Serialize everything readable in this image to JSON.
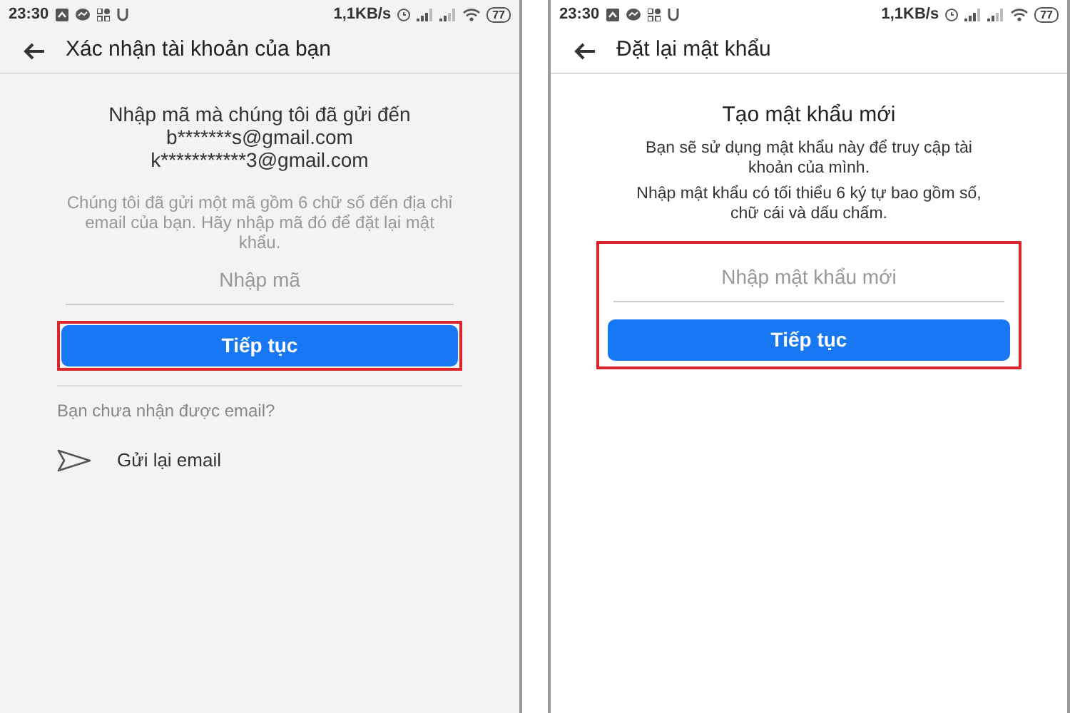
{
  "screens": [
    {
      "kind": "verify",
      "status_bar": {
        "time": "23:30",
        "speed": "1,1KB/s",
        "battery": "77"
      },
      "header": {
        "title": "Xác nhận tài khoản của bạn"
      },
      "message_lines": [
        "Nhập mã mà chúng tôi đã gửi đến",
        "b*******s@gmail.com",
        "k***********3@gmail.com"
      ],
      "hint": "Chúng tôi đã gửi một mã gồm 6 chữ số đến địa chỉ email của bạn. Hãy nhập mã đó để đặt lại mật khẩu.",
      "field": {
        "placeholder": "Nhập mã"
      },
      "button": {
        "label": "Tiếp tục",
        "highlighted": true
      },
      "question": "Bạn chưa nhận được email?",
      "resend": {
        "label": "Gửi lại email"
      }
    },
    {
      "kind": "reset",
      "status_bar": {
        "time": "23:30",
        "speed": "1,1KB/s",
        "battery": "77"
      },
      "header": {
        "title": "Đặt lại mật khẩu"
      },
      "heading": "Tạo mật khẩu mới",
      "description_lines": [
        "Bạn sẽ sử dụng mật khẩu này để truy cập tài khoản của mình.",
        "Nhập mật khẩu có tối thiểu 6 ký tự bao gồm số, chữ cái và dấu chấm."
      ],
      "field": {
        "placeholder": "Nhập mật khẩu mới"
      },
      "button": {
        "label": "Tiếp tục"
      },
      "highlighted": true
    }
  ]
}
